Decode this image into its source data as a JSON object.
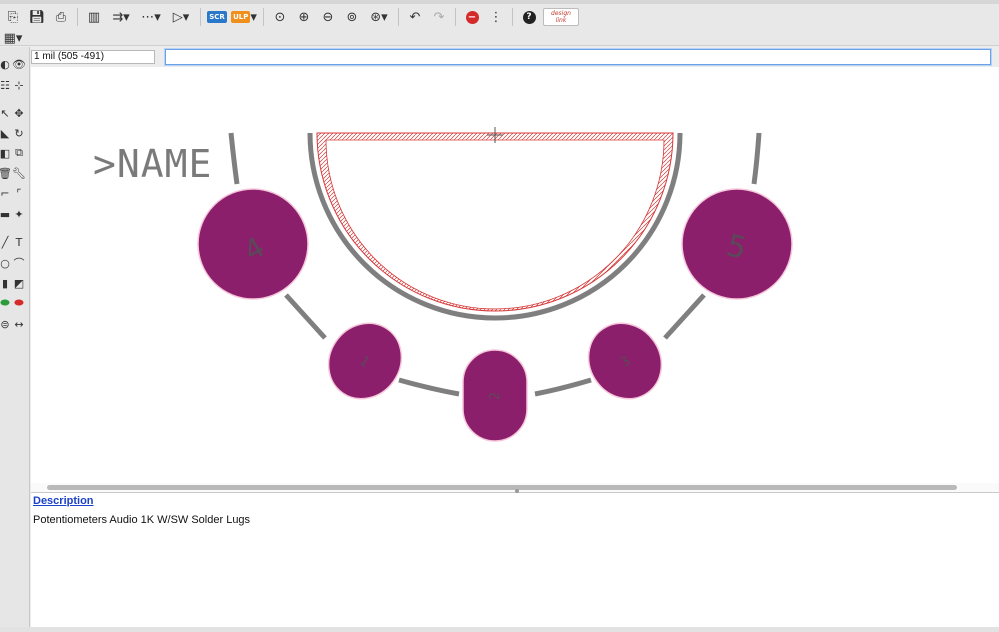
{
  "toolbar": {
    "scr_badge": "SCR",
    "ulp_badge": "ULP",
    "logo_top": "design",
    "logo_bottom": "link"
  },
  "coordinate_display": "1 mil (505 -491)",
  "command_input": {
    "value": ""
  },
  "layout": {
    "name_label": ">NAME",
    "pad_labels": [
      "4",
      "5",
      "1",
      "2",
      "3"
    ]
  },
  "colors": {
    "pad": "#8b1f6b",
    "outline": "#7f7f7f",
    "name_text": "#7a7a7a",
    "hatch": "#d63a3a",
    "link": "#1a40c8"
  },
  "description": {
    "heading": "Description",
    "text": "Potentiometers Audio 1K W/SW Solder Lugs"
  }
}
